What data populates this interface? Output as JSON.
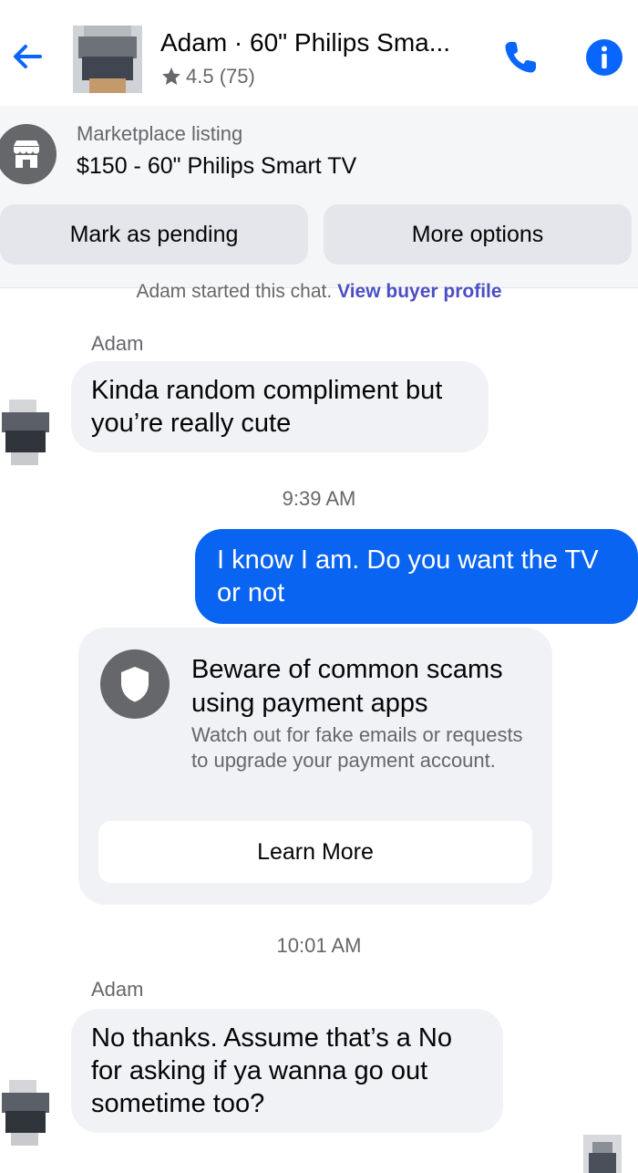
{
  "header": {
    "title": "Adam · 60\" Philips Sma...",
    "rating": "4.5 (75)",
    "icons": {
      "back": "back-arrow-icon",
      "call": "phone-icon",
      "info": "info-icon",
      "star": "star-icon"
    },
    "accent": "#0866ff"
  },
  "listing": {
    "label": "Marketplace listing",
    "price_title": "$150 - 60\" Philips Smart TV",
    "icon": "store-icon",
    "buttons": {
      "pending": "Mark as pending",
      "more": "More options"
    }
  },
  "chat": {
    "started_text": "Adam started this chat.",
    "view_profile": "View buyer profile",
    "messages": [
      {
        "sender": "Adam",
        "text": "Kinda random compliment but you’re really cute"
      },
      {
        "time": "9:39 AM"
      },
      {
        "sender": "me",
        "text": "I know I am. Do you want the TV or not"
      },
      {
        "time": "10:01 AM"
      },
      {
        "sender": "Adam",
        "text": "No thanks.  Assume that’s a No for asking if ya wanna go out sometime too?"
      }
    ],
    "outgoing_color": "#0a64f2"
  },
  "scam_card": {
    "icon": "shield-icon",
    "title": "Beware of common scams using payment apps",
    "body": "Watch out for fake emails or requests to upgrade your payment account.",
    "button": "Learn More"
  }
}
